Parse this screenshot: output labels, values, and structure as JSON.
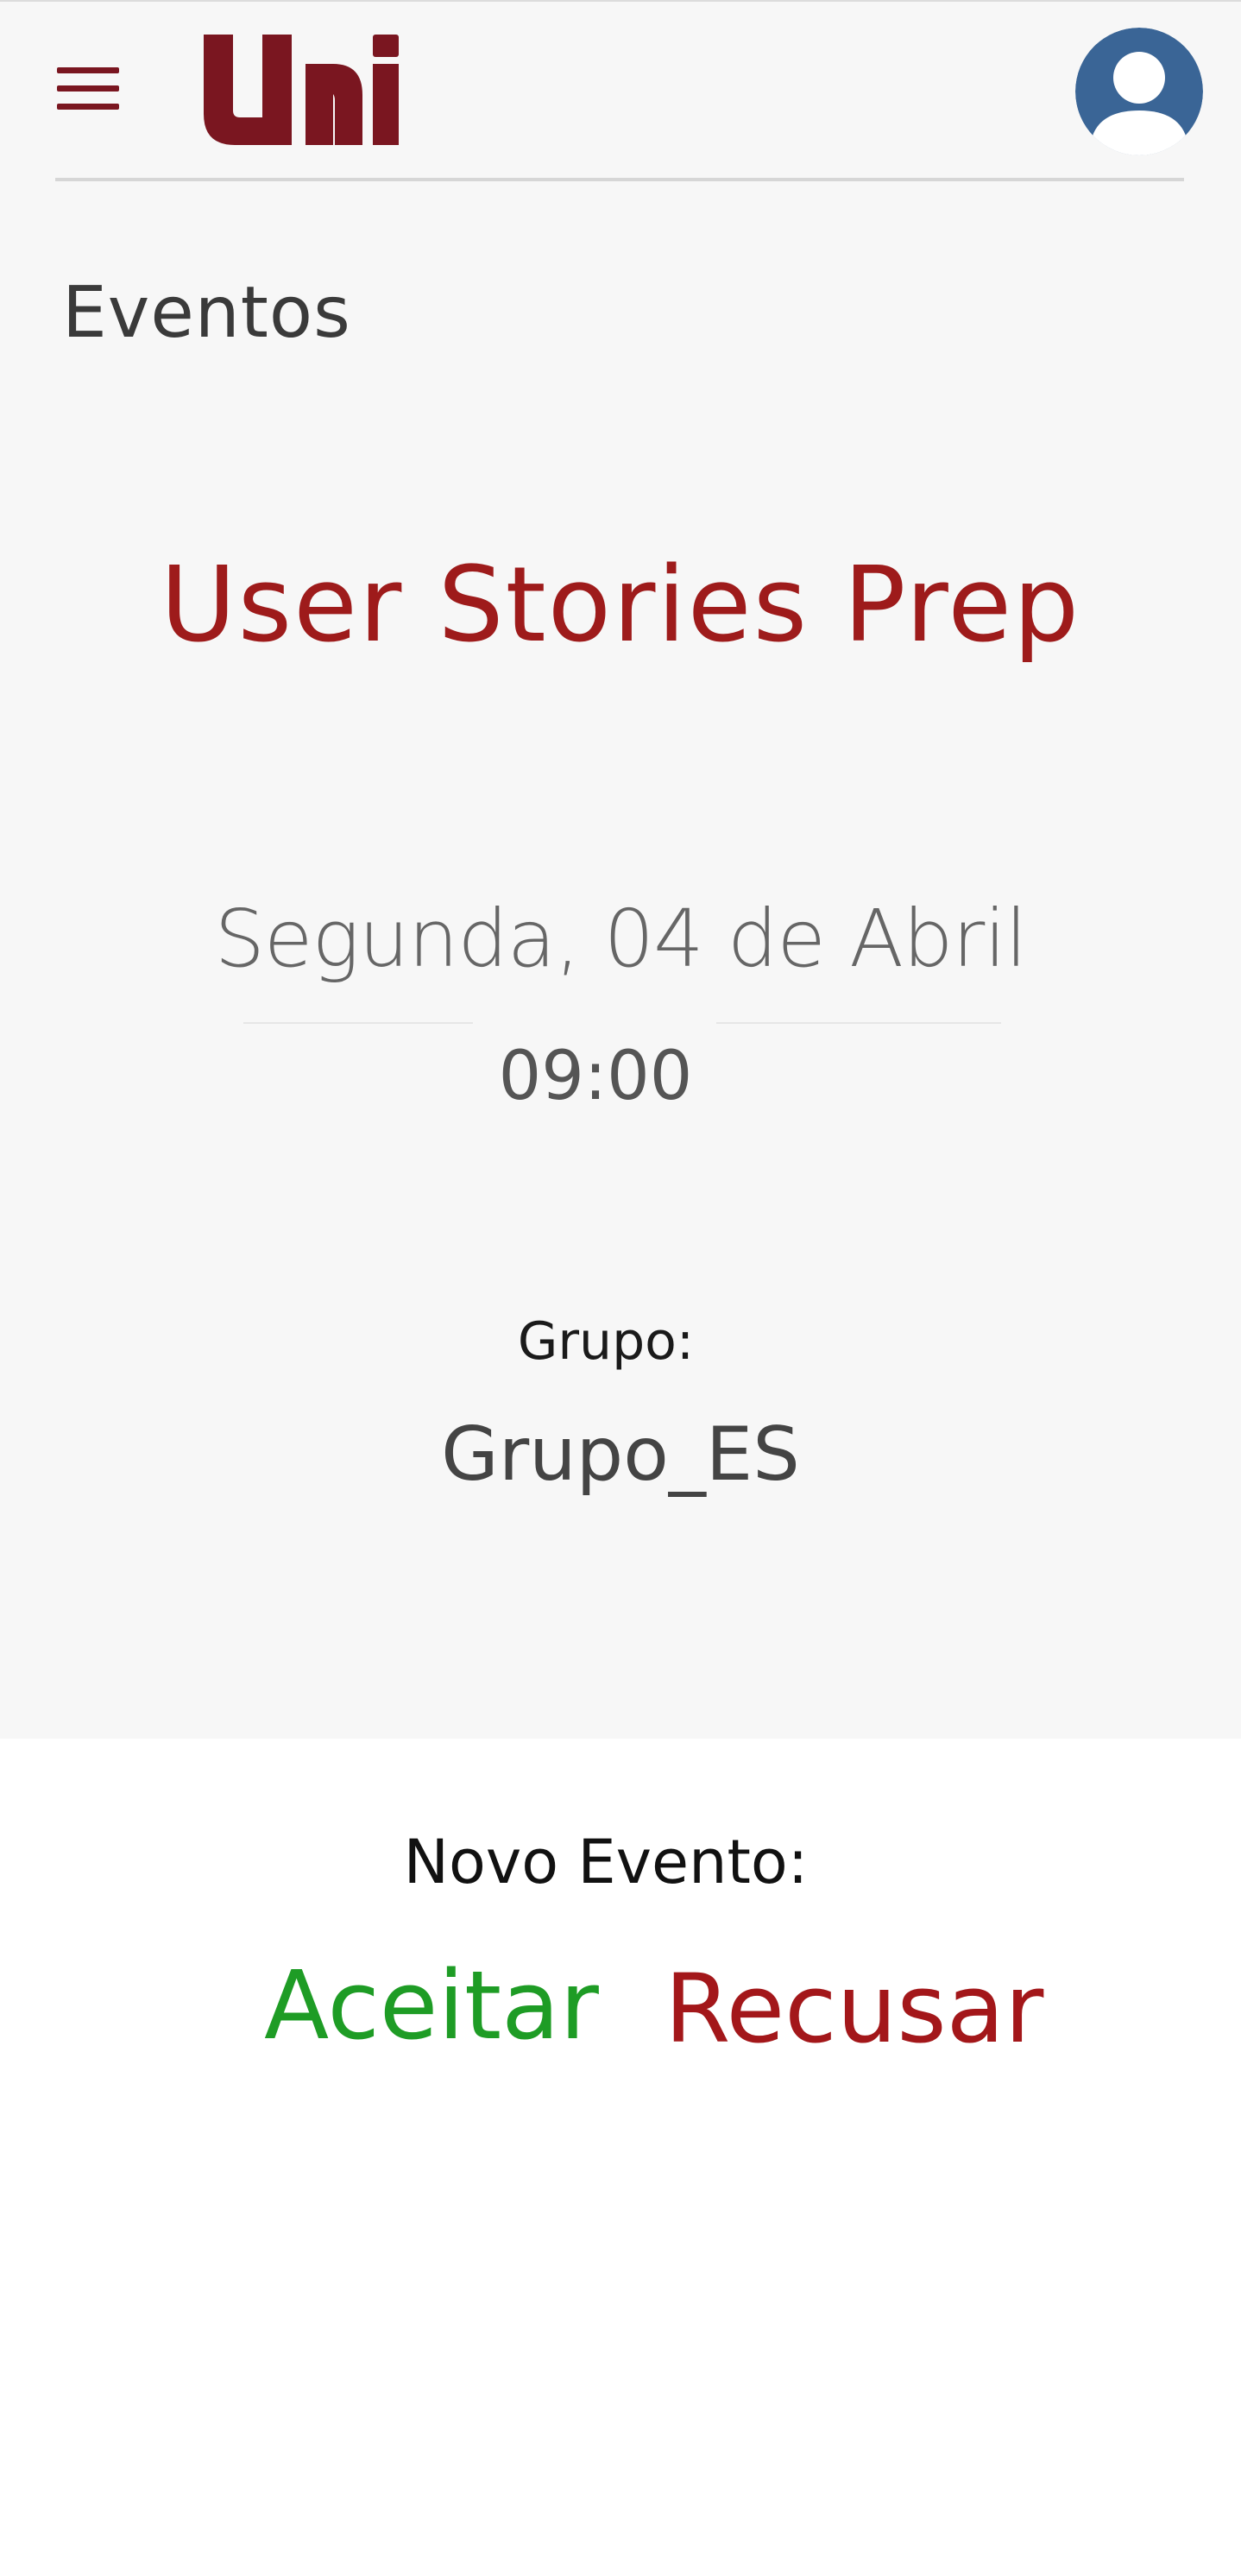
{
  "header": {
    "logo_text": "uni",
    "menu_icon": "hamburger-menu-icon",
    "avatar_icon": "user-avatar-icon"
  },
  "page": {
    "title": "Eventos"
  },
  "event": {
    "title": "User Stories Prep",
    "date": "Segunda, 04 de Abril",
    "time": "09:00",
    "group_label": "Grupo:",
    "group_value": "Grupo_ES"
  },
  "invite": {
    "label": "Novo Evento:",
    "accept_label": "Aceitar",
    "reject_label": "Recusar"
  },
  "colors": {
    "brand": "#7a1620",
    "event_title": "#9e1b1b",
    "accept": "#1e9c25",
    "reject": "#a3171a",
    "avatar": "#3a6596"
  }
}
